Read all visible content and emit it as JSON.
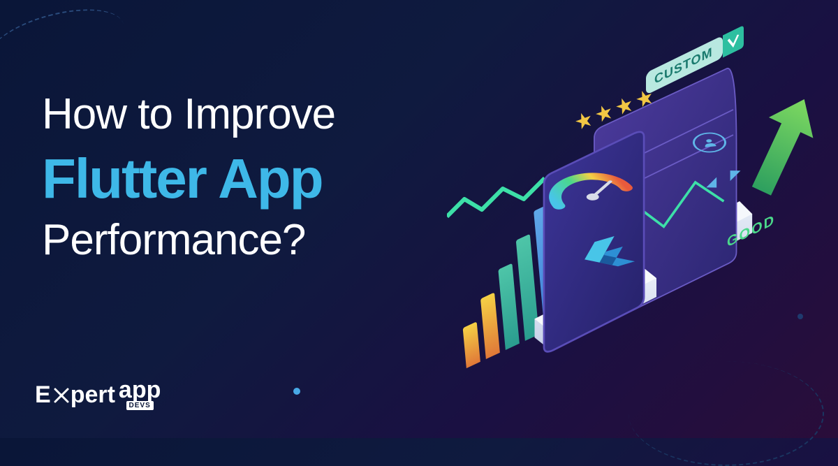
{
  "heading": {
    "line1": "How to Improve",
    "line2": "Flutter App",
    "line3": "Performance?"
  },
  "logo": {
    "part1": "E",
    "part2": "pert",
    "part3": "app",
    "sub": "DEVS"
  },
  "illustration": {
    "badge_custom": "CUSTOM",
    "badge_good": "GOOD"
  },
  "colors": {
    "accent": "#3eb8e8",
    "star": "#f2c744",
    "good": "#4bd88a"
  }
}
